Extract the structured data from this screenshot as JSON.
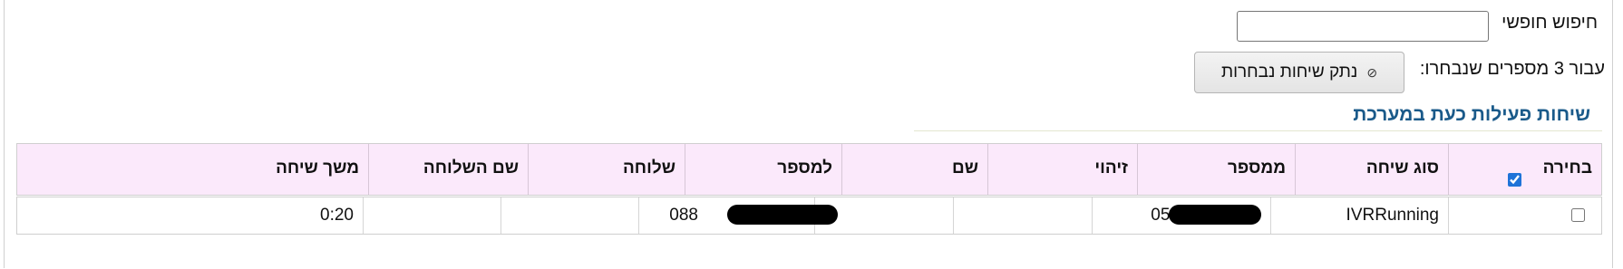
{
  "search": {
    "label": "חיפוש חופשי",
    "value": ""
  },
  "bulk": {
    "label": "עבור 3 מספרים שנבחרו:",
    "disconnect_label": "נתק שיחות נבחרות",
    "disconnect_icon": "cancel-circle-icon"
  },
  "section": {
    "title": "שיחות פעילות כעת במערכת"
  },
  "table": {
    "headers": {
      "select": "בחירה",
      "call_type": "סוג שיחה",
      "from_number": "ממספר",
      "id": "זיהוי",
      "name": "שם",
      "to_number": "למספר",
      "extension": "שלוחה",
      "extension_name": "שם השלוחה",
      "duration": "משך שיחה"
    },
    "select_all_checked": true,
    "rows": [
      {
        "selected": false,
        "call_type": "IVRRunning",
        "from_number": "054",
        "id": "",
        "name": "",
        "to_number": "088",
        "extension": "",
        "extension_name": "",
        "duration": "0:20"
      }
    ]
  }
}
